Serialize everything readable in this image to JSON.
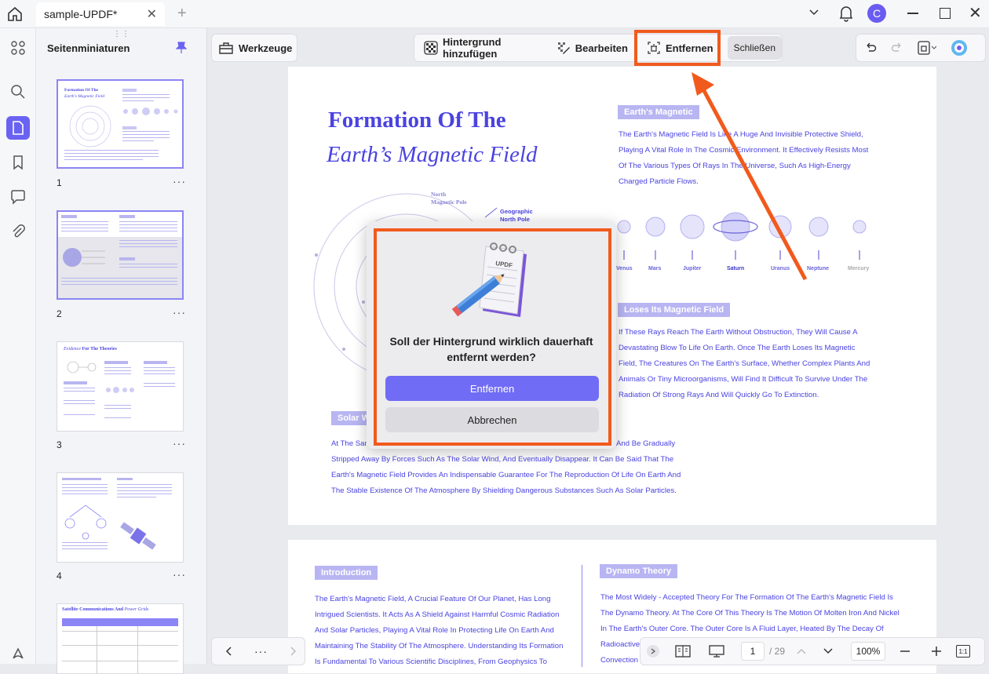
{
  "tab": {
    "title": "sample-UPDF*"
  },
  "user": {
    "avatar_letter": "C"
  },
  "sidebar": {
    "title": "Seitenminiaturen",
    "pages": [
      "1",
      "2",
      "3",
      "4"
    ]
  },
  "toolbar": {
    "tools_label": "Werkzeuge",
    "add_background": "Hintergrund hinzufügen",
    "edit": "Bearbeiten",
    "remove": "Entfernen",
    "close": "Schließen"
  },
  "document": {
    "title_line1": "Formation Of The",
    "title_line2": "Earth’s Magnetic Field",
    "north_label": "North\nMagnetic Pole",
    "geo_label": "Geographic\nNorth Pole",
    "section1_header": "Earth's Magnetic",
    "section1_lines": [
      "The Earth's Magnetic Field Is Like A Huge And Invisible Protective Shield,",
      "Playing A Vital Role In The Cosmic Environment. It Effectively Resists Most",
      "Of The Various Types Of Rays In The Universe, Such As High-Energy",
      "Charged Particle Flows."
    ],
    "planets": [
      "Venus",
      "Mars",
      "Jupiter",
      "Saturn",
      "Uranus",
      "Neptune",
      "Mercury"
    ],
    "section2_header": "Loses Its Magnetic Field",
    "section2_lines": [
      "If These Rays Reach The Earth Without Obstruction, They Will Cause A",
      "Devastating Blow To Life On Earth. Once The Earth Loses Its Magnetic",
      "Field, The Creatures On The Earth's Surface, Whether Complex Plants And",
      "Animals Or Tiny Microorganisms, Will Find It Difficult To Survive Under The",
      "Radiation Of Strong Rays And Will Quickly Go To Extinction."
    ],
    "solar_header": "Solar W",
    "bottom_line1_start": "At The Sam",
    "bottom_line1_end": "And Be Gradually",
    "bottom_lines": [
      "Stripped Away By Forces Such As The Solar Wind, And Eventually Disappear. It Can Be Said That The",
      "Earth's Magnetic Field Provides An Indispensable Guarantee For The Reproduction Of Life On Earth And",
      "The Stable Existence Of The Atmosphere By Shielding Dangerous Substances Such As Solar Particles."
    ],
    "page2_intro_header": "Introduction",
    "page2_intro_lines": [
      "The Earth's Magnetic Field, A Crucial Feature Of Our Planet, Has Long",
      "Intrigued Scientists. It Acts As A Shield Against Harmful Cosmic Radiation",
      "And Solar Particles, Playing A Vital Role In Protecting Life On Earth And",
      "Maintaining The Stability Of The Atmosphere. Understanding Its Formation",
      "Is Fundamental To Various Scientific Disciplines, From Geophysics To"
    ],
    "page2_dynamo_header": "Dynamo Theory",
    "page2_dynamo_lines": [
      "The Most Widely - Accepted Theory For The Formation Of The Earth's Magnetic Field Is",
      "The Dynamo Theory. At The Core Of This Theory Is The Motion Of Molten Iron And Nickel",
      "In The Earth's Outer Core. The Outer Core Is A Fluid Layer, Heated By The Decay Of",
      "Radioactive",
      "Convection C"
    ]
  },
  "dialog": {
    "icon_text": "UPDF",
    "message": "Soll der Hintergrund wirklich dauerhaft entfernt werden?",
    "confirm": "Entfernen",
    "cancel": "Abbrechen"
  },
  "bottom": {
    "page_current": "1",
    "page_total": "/ 29",
    "zoom": "100%",
    "fit_label": "1:1"
  },
  "thumb3": {
    "title_a": "Evidence",
    "title_b": "For The Theories"
  },
  "thumb5": {
    "title_a": "Satellite Communications And",
    "title_b": "Power Grids"
  },
  "colors": {
    "accent": "#4a43e0",
    "highlight": "#f15a1d",
    "button": "#716cf5"
  }
}
